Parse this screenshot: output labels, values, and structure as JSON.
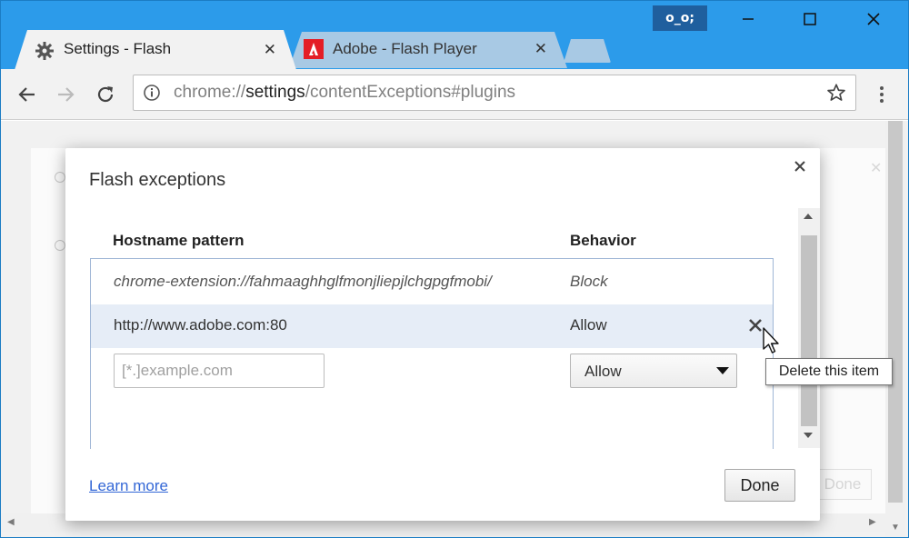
{
  "window": {
    "profile_badge": "o_o;",
    "tabs": [
      {
        "title": "Settings - Flash",
        "icon": "gear-icon",
        "active": true
      },
      {
        "title": "Adobe - Flash Player",
        "icon": "adobe-icon",
        "active": false
      }
    ],
    "tab_close": "✕"
  },
  "toolbar": {
    "url_prefix": "chrome://",
    "url_host": "settings",
    "url_path": "/contentExceptions#plugins"
  },
  "dialog": {
    "title": "Flash exceptions",
    "column_host": "Hostname pattern",
    "column_behavior": "Behavior",
    "rows": [
      {
        "host": "chrome-extension://fahmaaghhglfmonjliepjlchgpgfmobi/",
        "behavior": "Block"
      },
      {
        "host": "http://www.adobe.com:80",
        "behavior": "Allow"
      }
    ],
    "new_row": {
      "host_placeholder": "[*.]example.com",
      "behavior_selected": "Allow"
    },
    "learn_more": "Learn more",
    "done_label": "Done",
    "tooltip": "Delete this item"
  },
  "background": {
    "done_label": "Done",
    "close_glyph": "✕"
  },
  "colors": {
    "titlebar": "#2c9bea",
    "link": "#3367d6",
    "selected_row": "#e6edf7"
  }
}
